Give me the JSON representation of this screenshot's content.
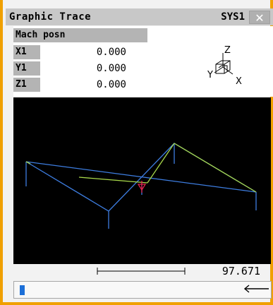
{
  "window": {
    "title": "Graphic Trace",
    "channel": "SYS1",
    "close_glyph": "✕"
  },
  "position": {
    "header": "Mach posn",
    "axes": [
      {
        "label": "X1",
        "value": "0.000"
      },
      {
        "label": "Y1",
        "value": "0.000"
      },
      {
        "label": "Z1",
        "value": "0.000"
      }
    ]
  },
  "triad": {
    "x": "X",
    "y": "Y",
    "z": "Z"
  },
  "scale": {
    "value": "97.671"
  },
  "colors": {
    "frame": "#f0a000",
    "path_blue": "#3d7de0",
    "path_green": "#a8d84a",
    "tool_marker": "#e0204a",
    "status_marker": "#1c6fd8"
  },
  "icons": {
    "close": "close-icon",
    "triad": "coordinate-triad-icon",
    "tool": "tool-position-icon",
    "arrow": "left-arrow-icon"
  }
}
